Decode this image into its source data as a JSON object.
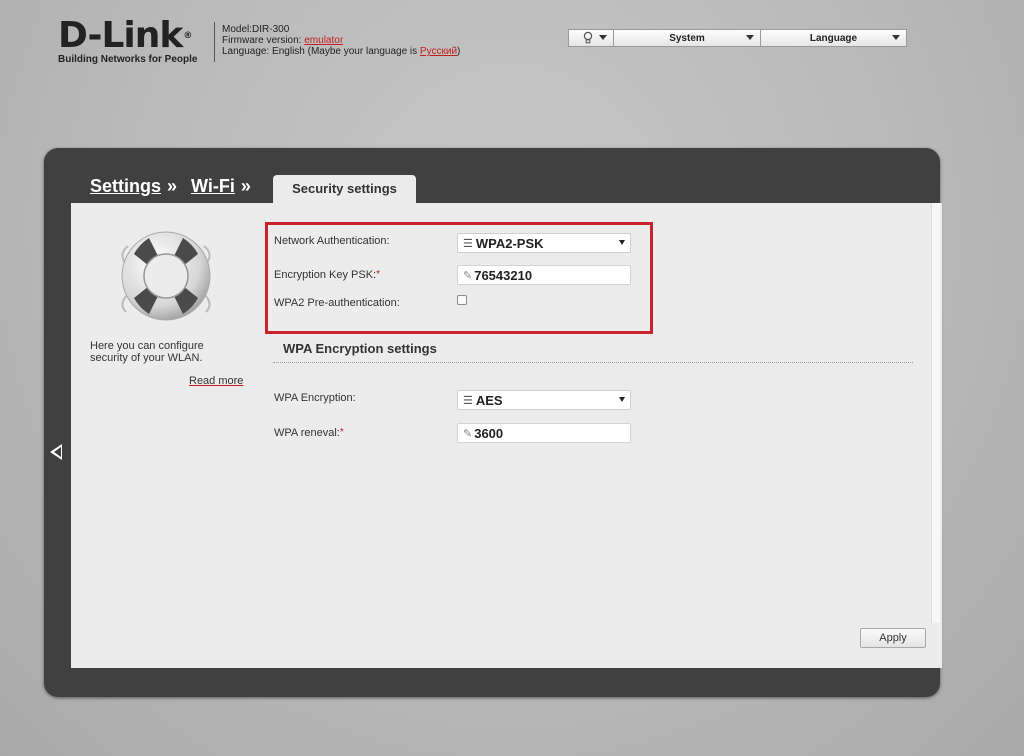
{
  "header": {
    "logo": "D-Link",
    "logo_reg": "®",
    "tagline": "Building Networks for People",
    "model_label": "Model:DIR-300",
    "firmware_label": "Firmware version: ",
    "firmware_value": "emulator",
    "language_label": "Language: English (Maybe your language is ",
    "language_suggestion": "Русский",
    "language_close": ")"
  },
  "topbar": {
    "system_label": "System",
    "language_label": "Language",
    "bulb_icon": "lightbulb-icon"
  },
  "breadcrumb": {
    "items": [
      "Settings",
      "Wi-Fi"
    ],
    "separator": "»",
    "active_tab": "Security settings"
  },
  "sidebar": {
    "icon": "lifebuoy-icon",
    "description": "Here you can configure security of your WLAN.",
    "read_more": "Read more"
  },
  "form": {
    "network_auth_label": "Network Authentication:",
    "network_auth_value": "WPA2-PSK",
    "psk_label": "Encryption Key PSK:",
    "psk_value": "76543210",
    "required_mark": "*",
    "preauth_label": "WPA2 Pre-authentication:",
    "preauth_checked": false,
    "section_title": "WPA Encryption settings",
    "wpa_encryption_label": "WPA Encryption:",
    "wpa_encryption_value": "AES",
    "wpa_renewal_label": "WPA reneval:",
    "wpa_renewal_value": "3600",
    "apply_label": "Apply"
  },
  "colors": {
    "accent_red": "#c8232c",
    "frame": "#404040",
    "panel": "#ececec"
  }
}
